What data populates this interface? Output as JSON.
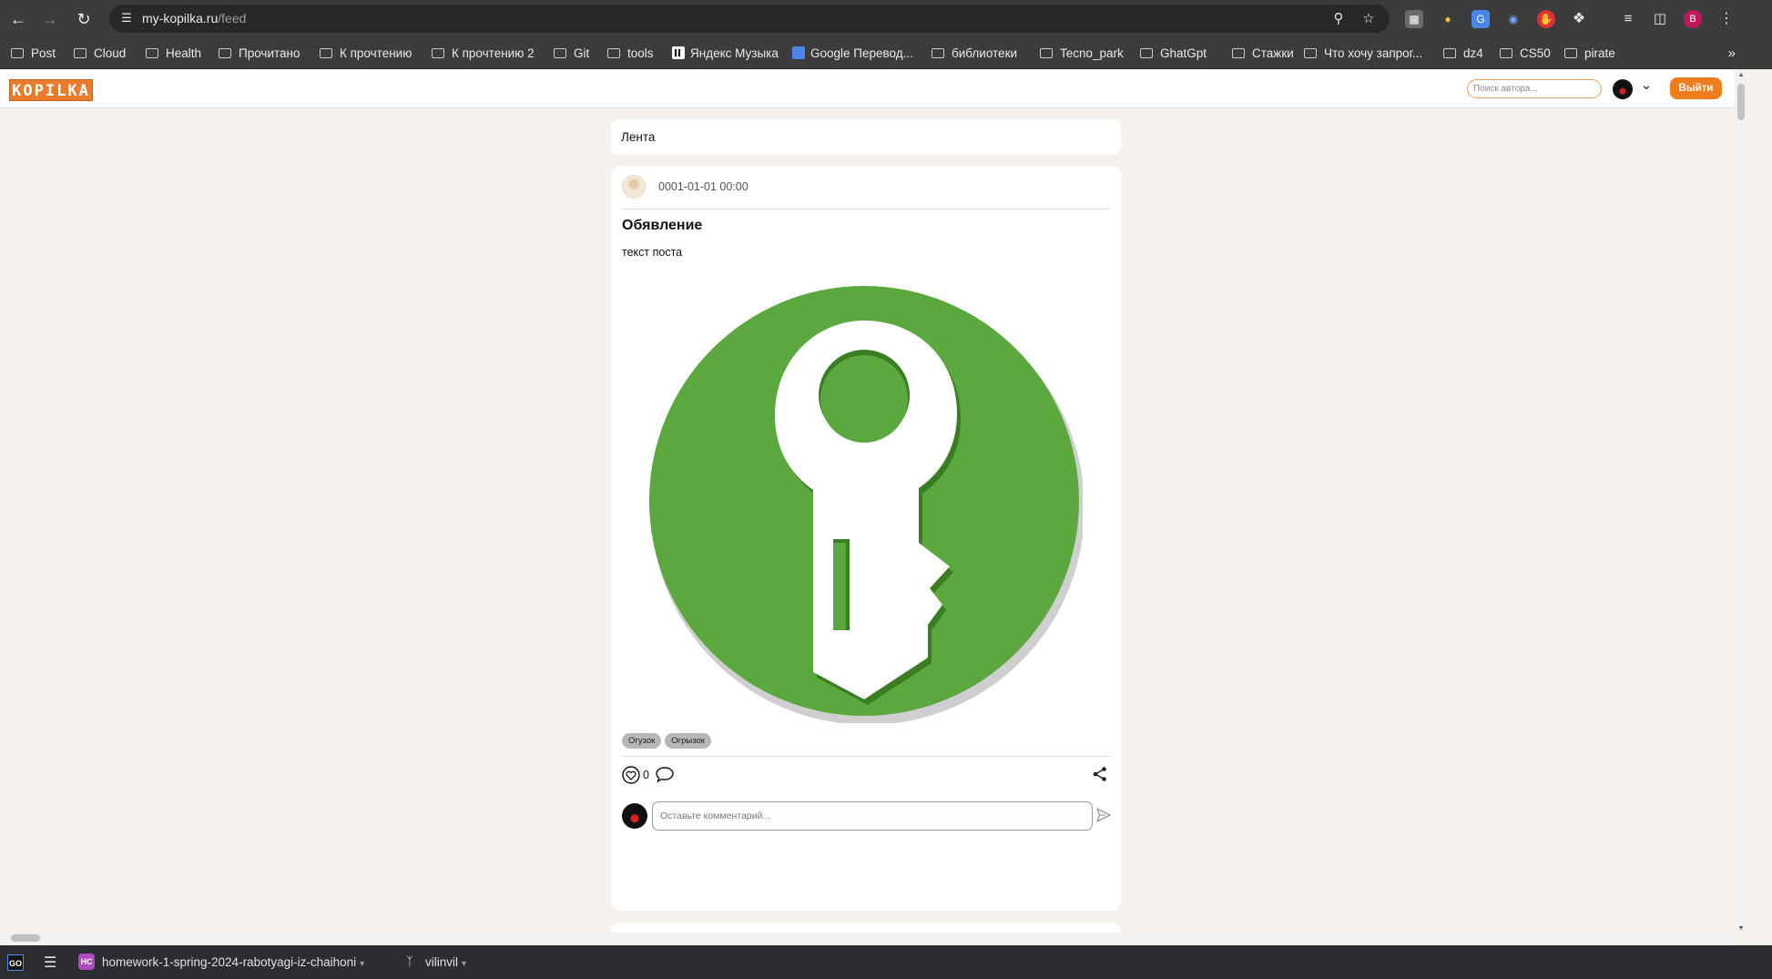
{
  "browser": {
    "url_host": "my-kopilka.ru",
    "url_path": "/feed",
    "icons": {
      "back": "arrow-left-icon",
      "forward": "arrow-right-icon",
      "reload": "reload-icon",
      "site_info": "tune-icon",
      "zoom": "magnifier-icon",
      "bookmark": "star-icon",
      "menu": "kebab-menu-icon"
    },
    "profile_initial": "B",
    "bookmarks": [
      {
        "label": "Post",
        "icon": "folder-icon"
      },
      {
        "label": "Cloud",
        "icon": "folder-icon"
      },
      {
        "label": "Health",
        "icon": "folder-icon"
      },
      {
        "label": "Прочитано",
        "icon": "folder-icon"
      },
      {
        "label": "К прочтению",
        "icon": "folder-icon"
      },
      {
        "label": "К прочтению 2",
        "icon": "folder-icon"
      },
      {
        "label": "Git",
        "icon": "folder-icon"
      },
      {
        "label": "tools",
        "icon": "folder-icon"
      },
      {
        "label": "Яндекс Музыка",
        "icon": "yandex-music-icon"
      },
      {
        "label": "Google Перевод...",
        "icon": "google-translate-icon"
      },
      {
        "label": "библиотеки",
        "icon": "folder-icon"
      },
      {
        "label": "Tecno_park",
        "icon": "folder-icon"
      },
      {
        "label": "GhatGpt",
        "icon": "folder-icon"
      },
      {
        "label": "Стажки",
        "icon": "folder-icon"
      },
      {
        "label": "Что хочу запрог...",
        "icon": "folder-icon"
      },
      {
        "label": "dz4",
        "icon": "folder-icon"
      },
      {
        "label": "CS50",
        "icon": "folder-icon"
      },
      {
        "label": "pirate",
        "icon": "folder-icon"
      }
    ]
  },
  "site": {
    "logo_text": "KOPILKA",
    "search_placeholder": "Поиск автора...",
    "logout_label": "Выйти",
    "feed_title": "Лента"
  },
  "post": {
    "date": "0001-01-01 00:00",
    "title": "Обявление",
    "text": "текст поста",
    "image": "green-key-icon",
    "tags": [
      "Огузок",
      "Огрызок"
    ],
    "likes": "0",
    "comment_placeholder": "Оставьте комментарий..."
  },
  "ide": {
    "logo_text": "GO",
    "project_badge": "HC",
    "project_name": "homework-1-spring-2024-rabotyagi-iz-chaihoni",
    "branch": "vilinvil"
  },
  "colors": {
    "accent_orange": "#f07c1c",
    "key_green": "#5ba83f",
    "page_bg": "#f5f1ec"
  }
}
